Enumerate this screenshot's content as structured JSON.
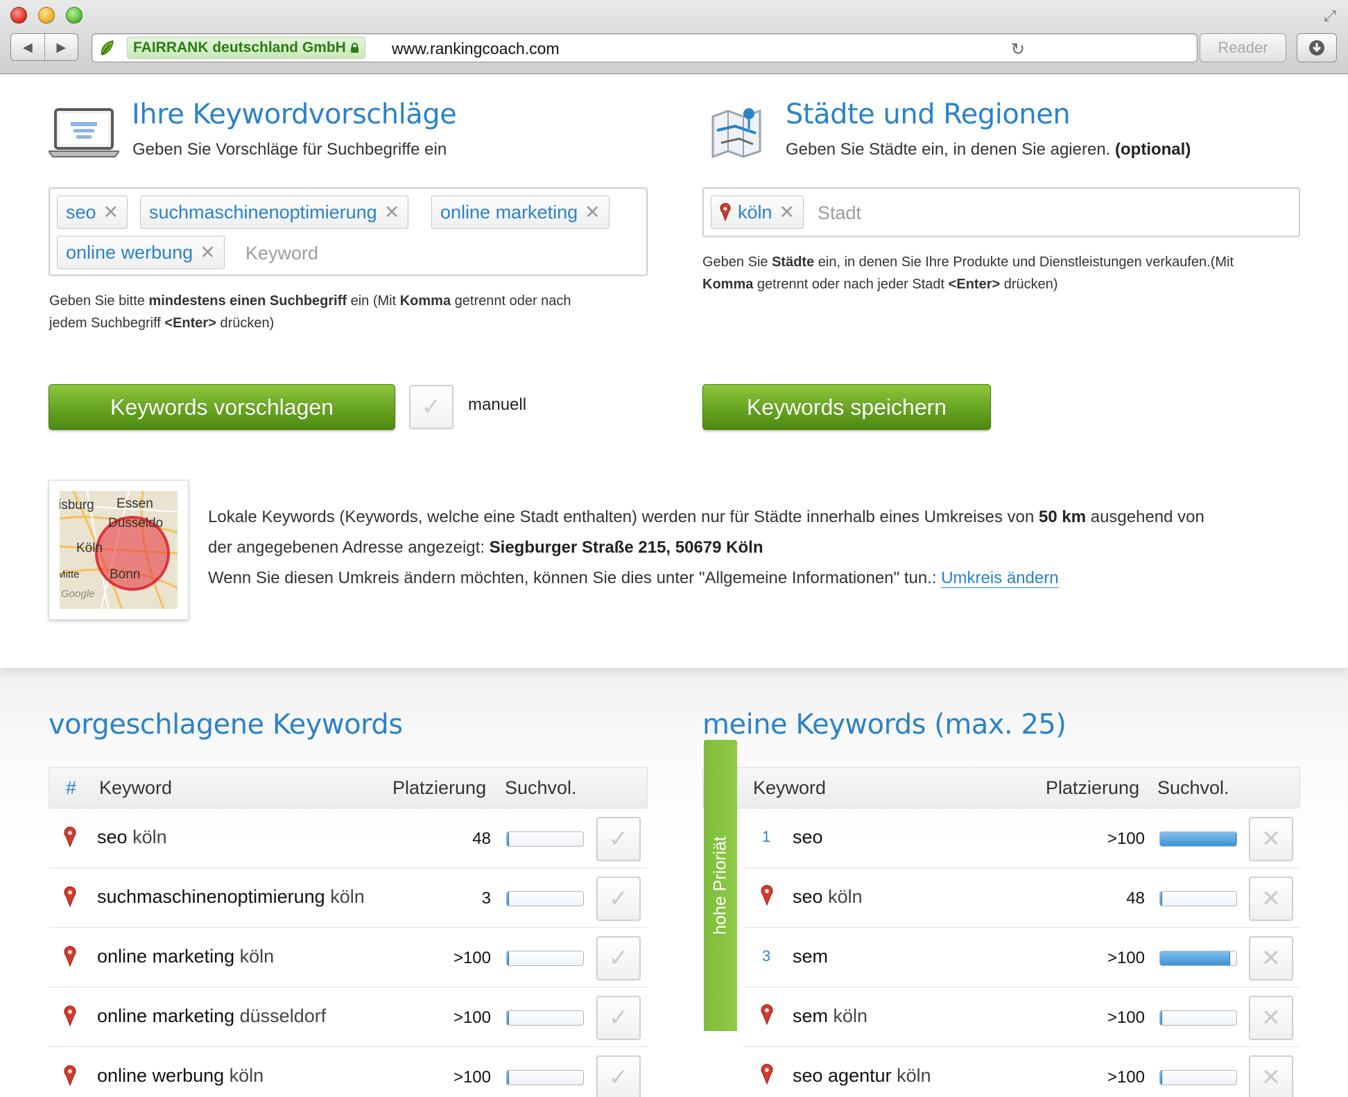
{
  "browser": {
    "ev_label": "FAIRRANK deutschland GmbH",
    "url": "www.rankingcoach.com",
    "reader_label": "Reader"
  },
  "keywords_section": {
    "title": "Ihre Keywordvorschläge",
    "subtitle": "Geben Sie Vorschläge für Suchbegriffe ein",
    "tags": [
      "seo",
      "suchmaschinenoptimierung",
      "online marketing",
      "online werbung"
    ],
    "input_placeholder": "Keyword",
    "hint_parts": [
      "Geben Sie bitte ",
      "mindestens einen Suchbegriff",
      " ein (Mit ",
      "Komma",
      " getrennt oder nach",
      "jedem Suchbegriff ",
      "<Enter>",
      " drücken)"
    ],
    "suggest_button": "Keywords vorschlagen",
    "manual_label": "manuell"
  },
  "cities_section": {
    "title": "Städte und Regionen",
    "subtitle": "Geben Sie Städte ein, in denen Sie agieren.",
    "subtitle_optional": "(optional)",
    "tags": [
      "köln"
    ],
    "input_placeholder": "Stadt",
    "hint_parts": [
      "Geben Sie ",
      "Städte",
      " ein, in denen Sie Ihre Produkte und Dienstleistungen verkaufen.(Mit",
      "Komma",
      " getrennt oder nach jeder Stadt ",
      "<Enter>",
      " drücken)"
    ],
    "save_button": "Keywords speichern"
  },
  "map": {
    "labels": [
      "isburg",
      "Essen",
      "Düsseldo",
      "Köln",
      "Bonn",
      "Mitte",
      "Google"
    ]
  },
  "local_info": {
    "line1_pre": "Lokale Keywords (Keywords, welche eine Stadt enthalten) werden nur für Städte innerhalb eines Umkreises von ",
    "radius": "50 km",
    "line1_post": " ausgehend von",
    "line2_pre": "der angegebenen Adresse angezeigt: ",
    "address": "Siegburger Straße 215, 50679 Köln",
    "line3": "Wenn Sie diesen Umkreis ändern möchten, können Sie dies unter \"Allgemeine Informationen\" tun.: ",
    "link": "Umkreis ändern"
  },
  "suggested": {
    "title": "vorgeschlagene Keywords",
    "headers": {
      "hash": "#",
      "keyword": "Keyword",
      "placement": "Platzierung",
      "volume": "Suchvol."
    },
    "rows": [
      {
        "kw": "seo",
        "city": "köln",
        "placement": "48",
        "volume": 0.02
      },
      {
        "kw": "suchmaschinenoptimierung",
        "city": "köln",
        "placement": "3",
        "volume": 0.02
      },
      {
        "kw": "online marketing",
        "city": "köln",
        "placement": ">100",
        "volume": 0.02
      },
      {
        "kw": "online marketing",
        "city": "düsseldorf",
        "placement": ">100",
        "volume": 0.02
      },
      {
        "kw": "online werbung",
        "city": "köln",
        "placement": ">100",
        "volume": 0.02
      }
    ]
  },
  "mine": {
    "title": "meine Keywords (max. 25)",
    "headers": {
      "hash": "#",
      "keyword": "Keyword",
      "placement": "Platzierung",
      "volume": "Suchvol."
    },
    "priority_label": "hohe Prioriät",
    "rows": [
      {
        "marker": "1",
        "kw": "seo",
        "city": "",
        "placement": ">100",
        "volume": 1.0
      },
      {
        "marker": "pin",
        "kw": "seo",
        "city": "köln",
        "placement": "48",
        "volume": 0.02
      },
      {
        "marker": "3",
        "kw": "sem",
        "city": "",
        "placement": ">100",
        "volume": 0.92
      },
      {
        "marker": "pin",
        "kw": "sem",
        "city": "köln",
        "placement": ">100",
        "volume": 0.02
      },
      {
        "marker": "pin",
        "kw": "seo agentur",
        "city": "köln",
        "placement": ">100",
        "volume": 0.02
      }
    ]
  },
  "colors": {
    "accent": "#2b82c9",
    "green": "#66a320",
    "priority": "#8fca48"
  }
}
